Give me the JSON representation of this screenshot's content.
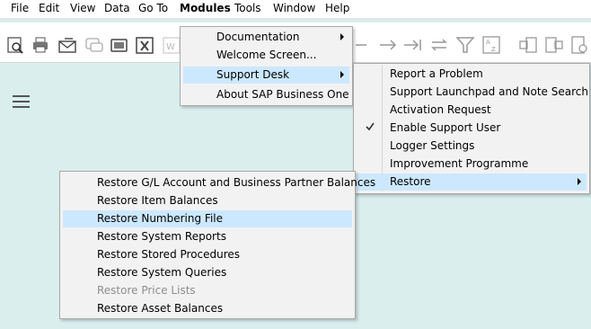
{
  "menubar": {
    "items": [
      {
        "label": "File"
      },
      {
        "label": "Edit"
      },
      {
        "label": "View"
      },
      {
        "label": "Data"
      },
      {
        "label": "Go To"
      },
      {
        "label": "Modules"
      },
      {
        "label": "Tools"
      },
      {
        "label": "Window"
      },
      {
        "label": "Help"
      }
    ]
  },
  "toolbar": {
    "icons": [
      "find-icon",
      "print-icon",
      "email-icon",
      "message-icon",
      "print-layout-icon",
      "excel-icon",
      "word-icon",
      "arrow-icon",
      "arrow-last-icon",
      "refresh-icon",
      "filter-icon",
      "sort-icon",
      "base-document-icon",
      "target-document-icon",
      "document-settings-icon"
    ]
  },
  "modules_menu": {
    "items": [
      {
        "label": "Documentation"
      },
      {
        "label": "Welcome Screen..."
      },
      {
        "label": "Support Desk"
      },
      {
        "label": "About SAP Business One"
      }
    ]
  },
  "support_desk_menu": {
    "items": [
      {
        "label": "Report a Problem"
      },
      {
        "label": "Support Launchpad and Note Search"
      },
      {
        "label": "Activation Request"
      },
      {
        "label": "Enable Support User",
        "checked": true
      },
      {
        "label": "Logger Settings"
      },
      {
        "label": "Improvement Programme"
      },
      {
        "label": "Restore"
      }
    ]
  },
  "restore_menu": {
    "items": [
      {
        "label": "Restore G/L Account and Business Partner Balances"
      },
      {
        "label": "Restore Item Balances"
      },
      {
        "label": "Restore Numbering File"
      },
      {
        "label": "Restore System Reports"
      },
      {
        "label": "Restore Stored Procedures"
      },
      {
        "label": "Restore System Queries"
      },
      {
        "label": "Restore Price Lists",
        "enabled": false
      },
      {
        "label": "Restore Asset Balances"
      }
    ]
  },
  "colors": {
    "workspace": "#daeeee",
    "menu_background": "#f2f2f2",
    "highlight": "#cce8ff",
    "disabled_text": "#8e8e8e"
  }
}
